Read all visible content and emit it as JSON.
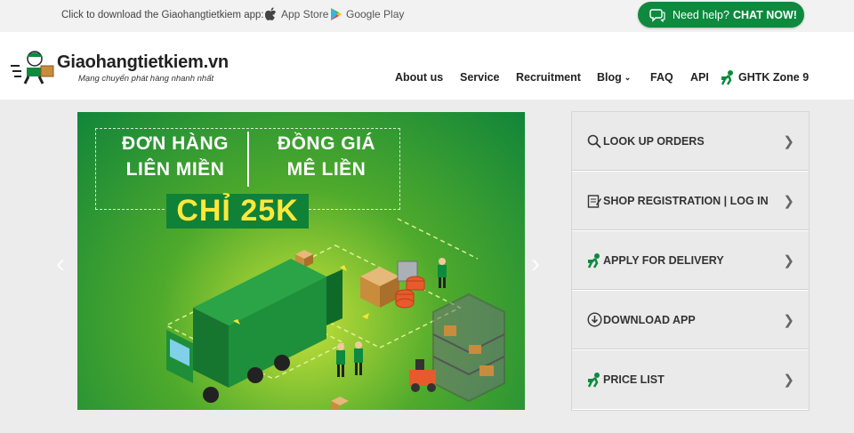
{
  "topbar": {
    "download_text": "Click to download the Giaohangtietkiem app:",
    "app_store": "App Store",
    "google_play": "Google Play",
    "help_text": "Need help?",
    "help_cta": "CHAT NOW!"
  },
  "header": {
    "brand": "Giaohangtietkiem.vn",
    "tagline": "Mạng chuyển phát hàng nhanh nhất",
    "nav": {
      "about": "About us",
      "service": "Service",
      "recruitment": "Recruitment",
      "blog": "Blog",
      "faq": "FAQ",
      "api": "API",
      "zone": "GHTK Zone 9"
    }
  },
  "banner": {
    "line1_left": "ĐƠN HÀNG",
    "line2_left": "LIÊN MIỀN",
    "line1_right": "ĐỒNG GIÁ",
    "line2_right": "MÊ LIỀN",
    "price": "CHỈ 25K"
  },
  "panel": {
    "items": [
      {
        "label": "LOOK UP ORDERS",
        "icon": "search-icon"
      },
      {
        "label": "SHOP REGISTRATION | LOG IN",
        "icon": "register-icon"
      },
      {
        "label": "APPLY FOR DELIVERY",
        "icon": "courier-icon"
      },
      {
        "label": "DOWNLOAD APP",
        "icon": "download-icon"
      },
      {
        "label": "PRICE LIST",
        "icon": "courier-icon"
      }
    ]
  },
  "colors": {
    "brand_green": "#0d8a3e",
    "banner_yellow": "#ffe83a"
  }
}
